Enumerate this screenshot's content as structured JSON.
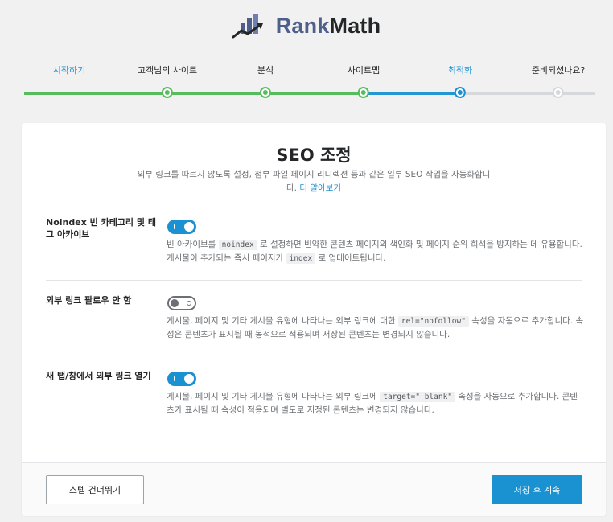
{
  "logo": {
    "text_rank": "Rank",
    "text_math": "Math",
    "icon": "rankmath-logo-icon"
  },
  "steps": [
    {
      "label": "시작하기",
      "state": "active-label"
    },
    {
      "label": "고객님의 사이트",
      "state": "done"
    },
    {
      "label": "분석",
      "state": "done"
    },
    {
      "label": "사이트맵",
      "state": "done"
    },
    {
      "label": "최적화",
      "state": "current"
    },
    {
      "label": "준비되셨나요?",
      "state": "pending"
    }
  ],
  "card": {
    "title": "SEO 조정",
    "description": "외부 링크를 따르지 않도록 설정, 첨부 파일 페이지 리디렉션 등과 같은 일부 SEO 작업을 자동화합니다.",
    "learn_more": "더 알아보기"
  },
  "settings": [
    {
      "label": "Noindex 빈 카테고리 및 태그 아카이브",
      "enabled": true,
      "desc_before": "빈 아카이브를 ",
      "code1": "noindex",
      "desc_mid": " 로 설정하면 빈약한 콘텐츠 페이지의 색인화 및 페이지 순위 희석을 방지하는 데 유용합니다. 게시물이 추가되는 즉시 페이지가 ",
      "code2": "index",
      "desc_after": " 로 업데이트됩니다."
    },
    {
      "label": "외부 링크 팔로우 안 함",
      "enabled": false,
      "desc_before": "게시물, 페이지 및 기타 게시물 유형에 나타나는 외부 링크에 대한 ",
      "code1": "rel=\"nofollow\"",
      "desc_after": " 속성을 자동으로 추가합니다. 속성은 콘텐츠가 표시될 때 동적으로 적용되며 저장된 콘텐츠는 변경되지 않습니다."
    },
    {
      "label": "새 탭/창에서 외부 링크 열기",
      "enabled": true,
      "desc_before": "게시물, 페이지 및 기타 게시물 유형에 나타나는 외부 링크에 ",
      "code1": "target=\"_blank\"",
      "desc_after": " 속성을 자동으로 추가합니다. 콘텐츠가 표시될 때 속성이 적용되며 별도로 지정된 콘텐츠는 변경되지 않습니다."
    }
  ],
  "footer": {
    "skip_label": "스텝 건너뛰기",
    "save_label": "저장 후 계속"
  },
  "colors": {
    "accent": "#1a91d0",
    "done": "#56bc5e",
    "pending": "#d6d8dc"
  }
}
